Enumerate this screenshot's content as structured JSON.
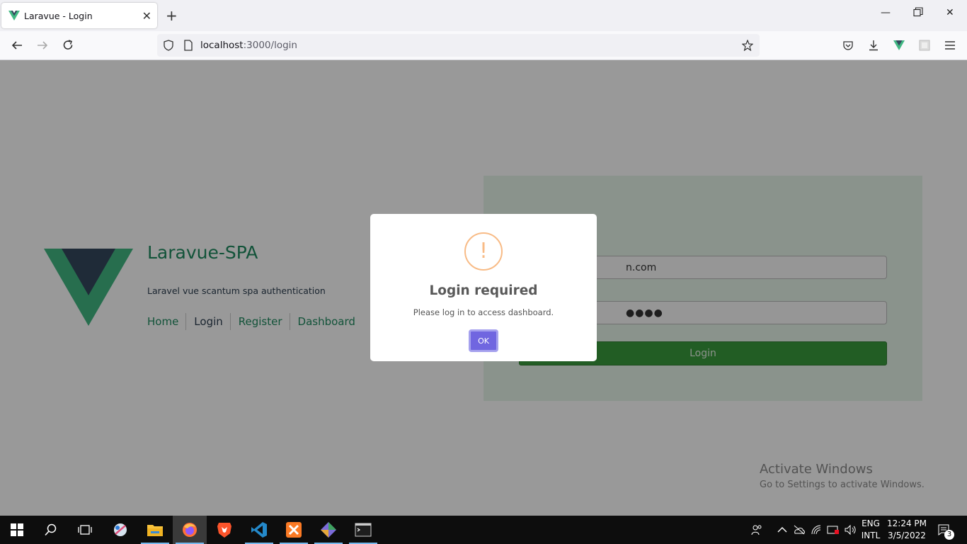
{
  "browser": {
    "tab_title": "Laravue - Login",
    "url_host": "localhost",
    "url_path": ":3000/login"
  },
  "page": {
    "brand_title": "Laravue-SPA",
    "brand_subtitle": "Laravel vue scantum spa authentication",
    "nav": [
      {
        "label": "Home",
        "active": false
      },
      {
        "label": "Login",
        "active": true
      },
      {
        "label": "Register",
        "active": false
      },
      {
        "label": "Dashboard",
        "active": false
      }
    ],
    "form": {
      "email_value": "n.com",
      "password_value": "●●●●",
      "login_label": "Login"
    },
    "watermark": {
      "line1": "Activate Windows",
      "line2": "Go to Settings to activate Windows."
    }
  },
  "modal": {
    "icon": "!",
    "title": "Login required",
    "text": "Please log in to access dashboard.",
    "ok_label": "OK"
  },
  "taskbar": {
    "lang": "ENG",
    "layout": "INTL",
    "time": "12:24 PM",
    "date": "3/5/2022",
    "notifications": "3"
  },
  "colors": {
    "brand_green": "#1f8a60",
    "modal_button": "#7066e0",
    "warning_icon": "#f8bb86"
  }
}
